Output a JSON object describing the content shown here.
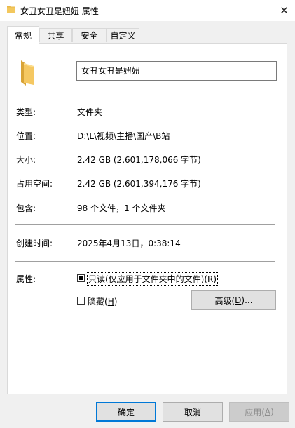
{
  "window": {
    "title": "女丑女丑是妞妞 属性",
    "close_glyph": "✕",
    "folder_color": "#e8b84b"
  },
  "tabs": [
    {
      "label": "常规",
      "active": true
    },
    {
      "label": "共享",
      "active": false
    },
    {
      "label": "安全",
      "active": false
    },
    {
      "label": "自定义",
      "active": false
    }
  ],
  "general": {
    "name": "女丑女丑是妞妞",
    "type_label": "类型:",
    "type_value": "文件夹",
    "location_label": "位置:",
    "location_value": "D:\\L\\视频\\主播\\国产\\B站",
    "size_label": "大小:",
    "size_value": "2.42 GB (2,601,178,066 字节)",
    "size_on_disk_label": "占用空间:",
    "size_on_disk_value": "2.42 GB (2,601,394,176 字节)",
    "contains_label": "包含:",
    "contains_value": "98 个文件，1 个文件夹",
    "created_label": "创建时间:",
    "created_value": "2025年4月13日，0:38:14",
    "attributes_label": "属性:",
    "readonly_label_pre": "只读(仅应用于文件夹中的文件)(",
    "readonly_hotkey": "R",
    "readonly_label_post": ")",
    "readonly_state": "indeterminate",
    "hidden_label_pre": "隐藏(",
    "hidden_hotkey": "H",
    "hidden_label_post": ")",
    "hidden_checked": false,
    "advanced_label_pre": "高级(",
    "advanced_hotkey": "D",
    "advanced_label_post": ")..."
  },
  "footer": {
    "ok_label": "确定",
    "cancel_label": "取消",
    "apply_label_pre": "应用(",
    "apply_hotkey": "A",
    "apply_label_post": ")",
    "apply_enabled": false
  }
}
